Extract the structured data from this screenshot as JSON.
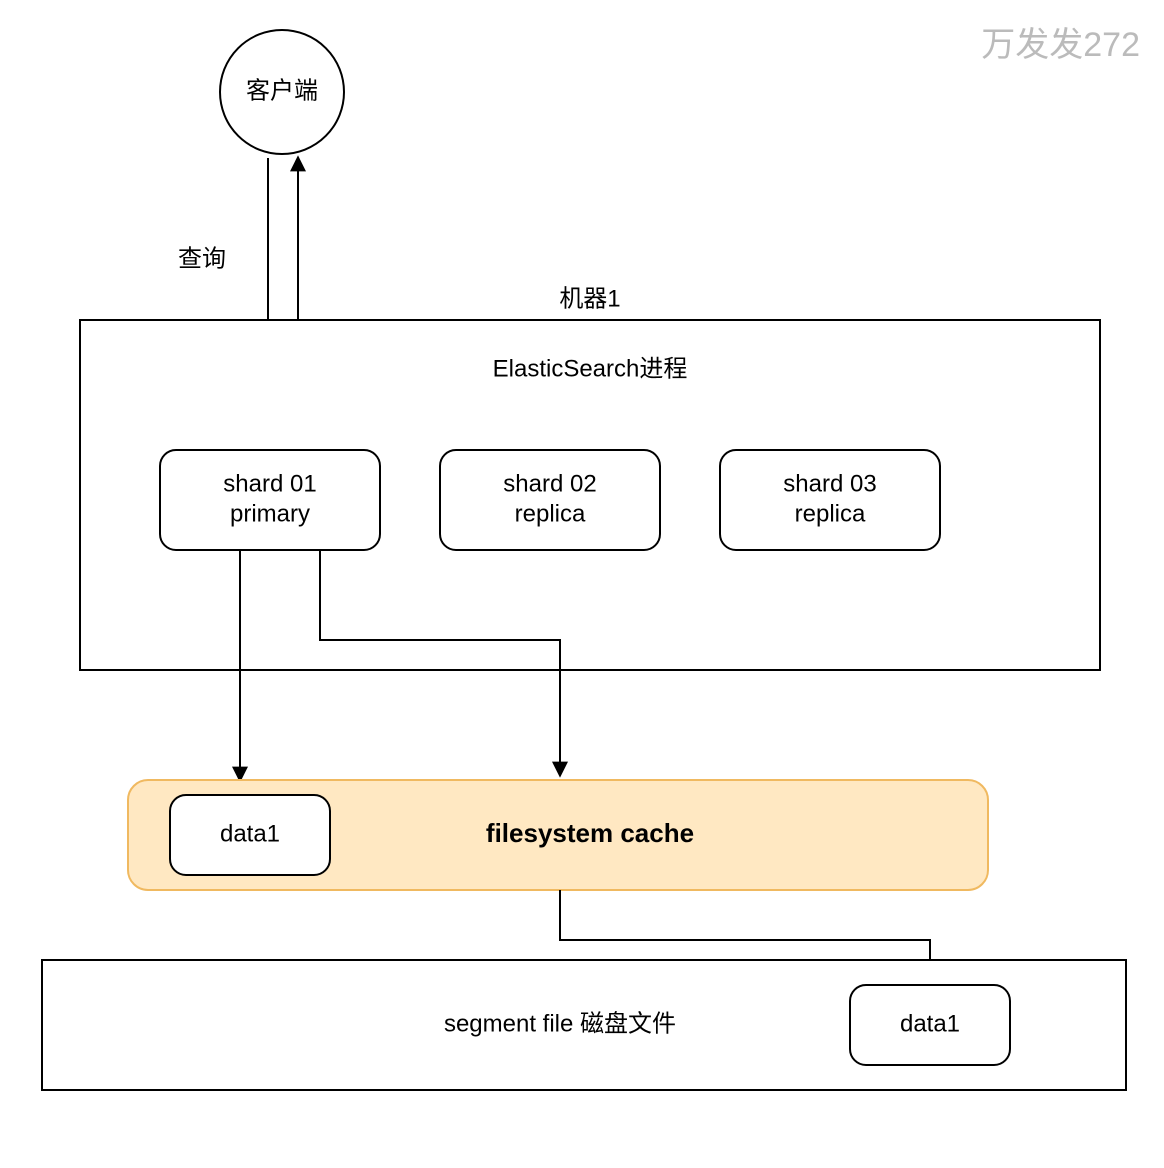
{
  "watermark": "万发发272",
  "client": {
    "label": "客户端",
    "queryLabel": "查询"
  },
  "machine": {
    "title": "机器1",
    "processTitle": "ElasticSearch进程",
    "shards": [
      {
        "line1": "shard 01",
        "line2": "primary"
      },
      {
        "line1": "shard 02",
        "line2": "replica"
      },
      {
        "line1": "shard 03",
        "line2": "replica"
      }
    ]
  },
  "cache": {
    "title": "filesystem cache",
    "data": "data1"
  },
  "disk": {
    "title": "segment file 磁盘文件",
    "data": "data1"
  }
}
